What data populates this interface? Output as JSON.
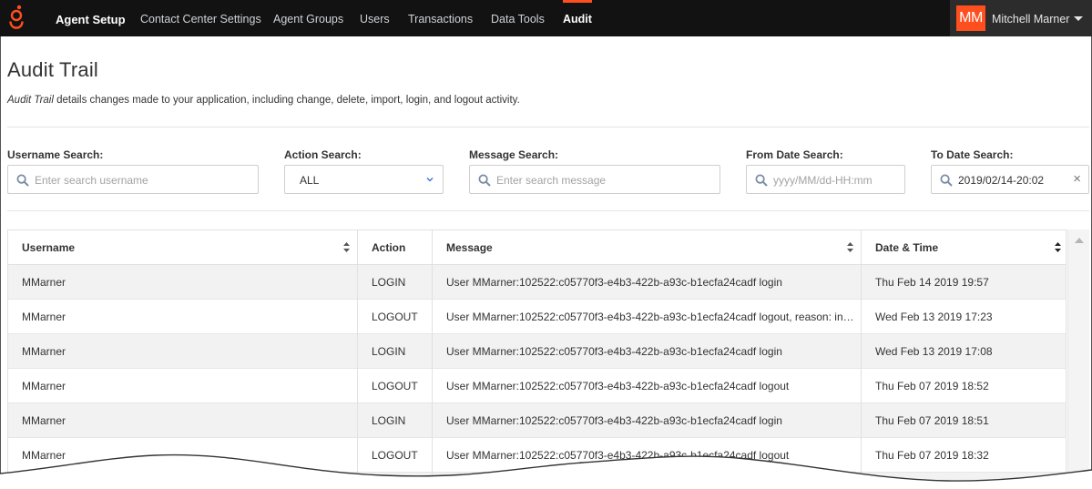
{
  "nav": {
    "brand": "Agent Setup",
    "items": [
      "Contact Center Settings",
      "Agent Groups",
      "Users",
      "Transactions",
      "Data Tools"
    ],
    "active": "Audit",
    "user_initials": "MM",
    "user_name": "Mitchell Marner"
  },
  "page": {
    "title": "Audit Trail",
    "desc_em": "Audit Trail",
    "desc_rest": " details changes made to your application, including change, delete, import, login, and logout activity."
  },
  "filters": {
    "username_label": "Username Search:",
    "username_placeholder": "Enter search username",
    "action_label": "Action Search:",
    "action_value": "ALL",
    "message_label": "Message Search:",
    "message_placeholder": "Enter search message",
    "from_label": "From Date Search:",
    "from_placeholder": "yyyy/MM/dd-HH:mm",
    "to_label": "To Date Search:",
    "to_value": "2019/02/14-20:02",
    "clear_symbol": "×"
  },
  "table": {
    "headers": [
      "Username",
      "Action",
      "Message",
      "Date & Time"
    ],
    "rows": [
      [
        "MMarner",
        "LOGIN",
        "User MMarner:102522:c05770f3-e4b3-422b-a93c-b1ecfa24cadf login",
        "Thu Feb 14 2019 19:57"
      ],
      [
        "MMarner",
        "LOGOUT",
        "User MMarner:102522:c05770f3-e4b3-422b-a93c-b1ecfa24cadf logout, reason: inactivity",
        "Wed Feb 13 2019 17:23"
      ],
      [
        "MMarner",
        "LOGIN",
        "User MMarner:102522:c05770f3-e4b3-422b-a93c-b1ecfa24cadf login",
        "Wed Feb 13 2019 17:08"
      ],
      [
        "MMarner",
        "LOGOUT",
        "User MMarner:102522:c05770f3-e4b3-422b-a93c-b1ecfa24cadf logout",
        "Thu Feb 07 2019 18:52"
      ],
      [
        "MMarner",
        "LOGIN",
        "User MMarner:102522:c05770f3-e4b3-422b-a93c-b1ecfa24cadf login",
        "Thu Feb 07 2019 18:51"
      ],
      [
        "MMarner",
        "LOGOUT",
        "User MMarner:102522:c05770f3-e4b3-422b-a93c-b1ecfa24cadf logout",
        "Thu Feb 07 2019 18:32"
      ]
    ]
  },
  "colors": {
    "accent": "#ff4f1f",
    "topbar": "#121212",
    "row_stripe": "#f2f2f2"
  },
  "icons": {
    "logo": "genesys-logo-icon",
    "search": "search-icon",
    "select": "chevron-down-icon",
    "sort": "sort-icon",
    "clear": "clear-icon",
    "user_menu": "caret-down-icon",
    "scroll": "scroll-up-icon"
  }
}
